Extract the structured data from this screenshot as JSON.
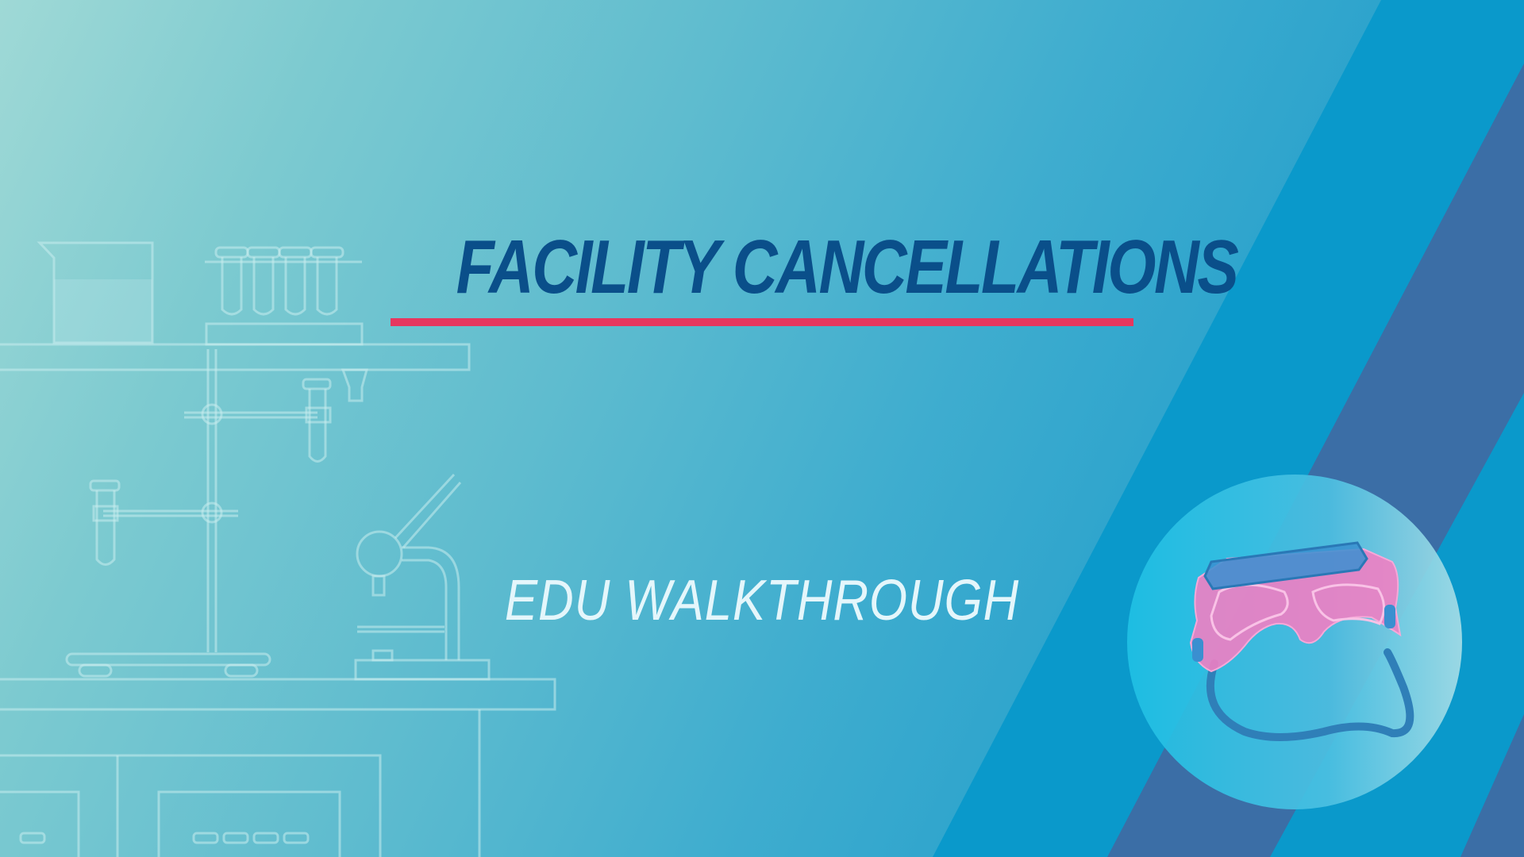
{
  "slide": {
    "title": "FACILITY CANCELLATIONS",
    "subtitle": "EDU WALKTHROUGH"
  },
  "icons": {
    "background": "lab-equipment-illustration",
    "badge": "safety-goggles-icon"
  },
  "colors": {
    "title": "#0a4f8a",
    "accent_rule": "#e6375f",
    "subtitle": "#e4f6fb",
    "stripe_light": "#0a99cb",
    "stripe_dark": "#3b6ea6",
    "goggles": "#ef7fc3"
  }
}
